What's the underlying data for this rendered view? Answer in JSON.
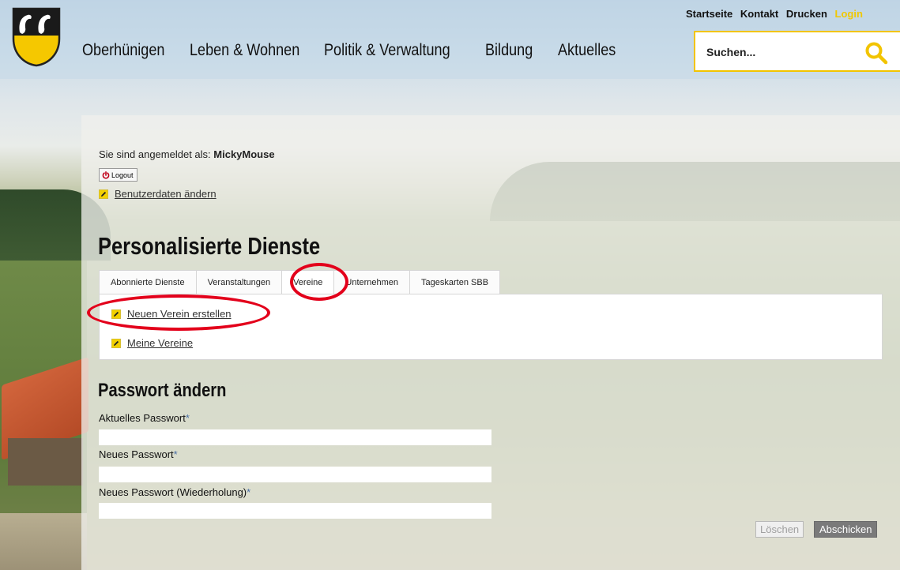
{
  "header": {
    "nav": [
      "Oberhünigen",
      "Leben & Wohnen",
      "Politik & Verwaltung",
      "Bildung",
      "Aktuelles"
    ],
    "top_links": [
      "Startseite",
      "Kontakt",
      "Drucken",
      "Login"
    ],
    "search_placeholder": "Suchen..."
  },
  "user": {
    "logged_in_prefix": "Sie sind angemeldet als:",
    "username": "MickyMouse",
    "logout_label": "Logout",
    "edit_user_link": "Benutzerdaten ändern"
  },
  "services": {
    "title": "Personalisierte Dienste",
    "tabs": [
      "Abonnierte Dienste",
      "Veranstaltungen",
      "Vereine",
      "Unternehmen",
      "Tageskarten SBB"
    ],
    "active_tab": "Vereine",
    "links": [
      "Neuen Verein erstellen",
      "Meine Vereine"
    ]
  },
  "password": {
    "title": "Passwort ändern",
    "fields": [
      {
        "label": "Aktuelles Passwort",
        "required_mark": "*",
        "value": ""
      },
      {
        "label": "Neues Passwort",
        "required_mark": "*",
        "value": ""
      },
      {
        "label": "Neues Passwort (Wiederholung)",
        "required_mark": "*",
        "value": ""
      }
    ],
    "clear_label": "Löschen",
    "submit_label": "Abschicken"
  },
  "colors": {
    "accent_yellow": "#f2c400",
    "annotation_red": "#e3001b"
  }
}
